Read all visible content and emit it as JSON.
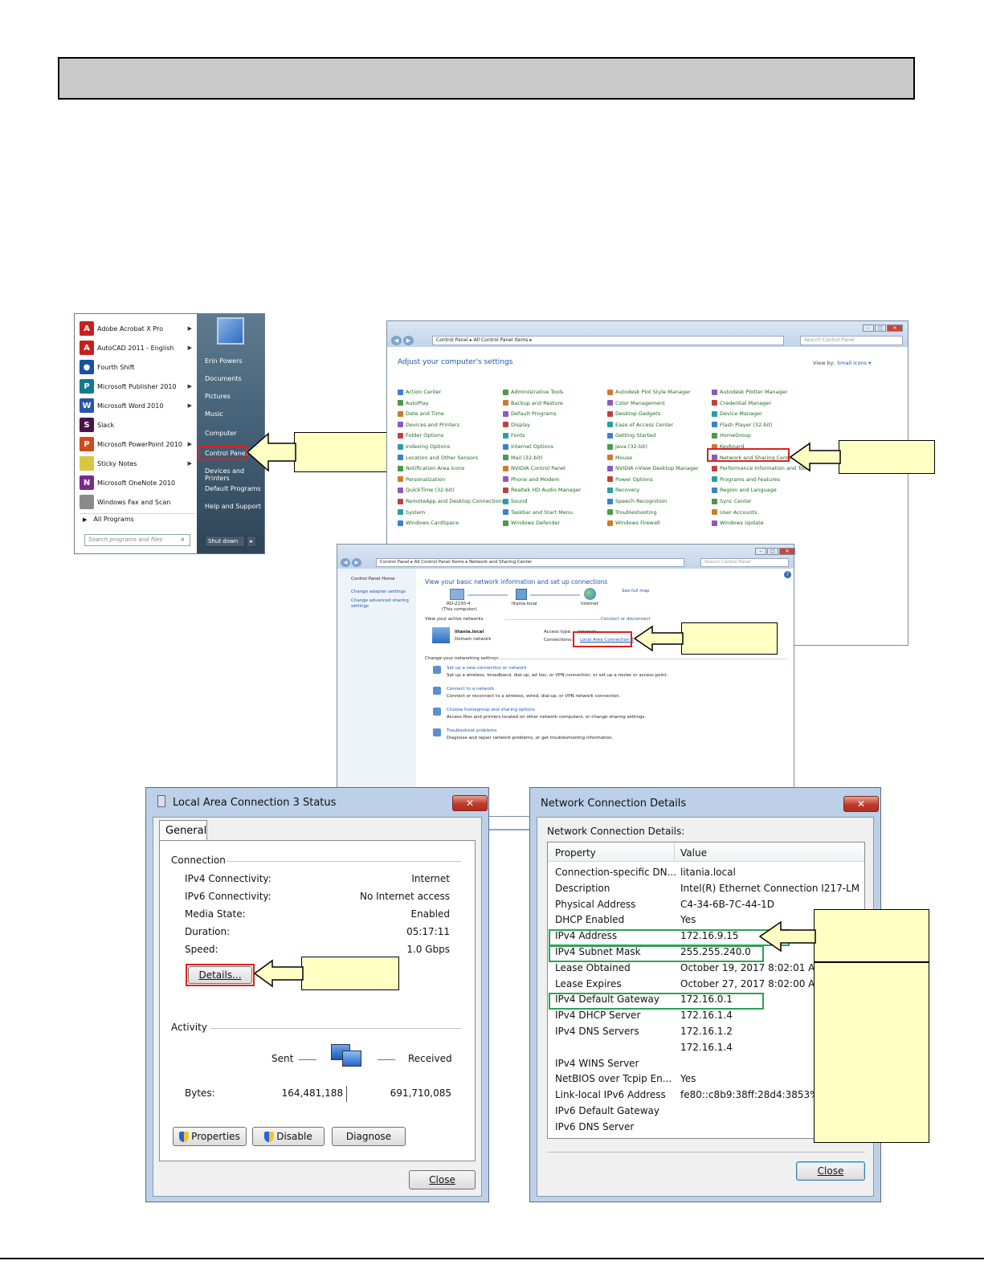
{
  "start_menu": {
    "programs": [
      {
        "label": "Adobe Acrobat X Pro",
        "icon": "acrobat-icon",
        "color": "#c8201f",
        "glyph": "A",
        "has_arrow": true
      },
      {
        "label": "AutoCAD 2011 - English",
        "icon": "autocad-icon",
        "color": "#c81e1e",
        "glyph": "A",
        "has_arrow": true
      },
      {
        "label": "Fourth Shift",
        "icon": "fourth-shift-icon",
        "color": "#1a4ea0",
        "glyph": "●",
        "has_arrow": false
      },
      {
        "label": "Microsoft Publisher 2010",
        "icon": "publisher-icon",
        "color": "#117a8b",
        "glyph": "P",
        "has_arrow": true
      },
      {
        "label": "Microsoft Word 2010",
        "icon": "word-icon",
        "color": "#2a55a8",
        "glyph": "W",
        "has_arrow": true
      },
      {
        "label": "Slack",
        "icon": "slack-icon",
        "color": "#4a154b",
        "glyph": "S",
        "has_arrow": false
      },
      {
        "label": "Microsoft PowerPoint 2010",
        "icon": "powerpoint-icon",
        "color": "#d04a1c",
        "glyph": "P",
        "has_arrow": true
      },
      {
        "label": "Sticky Notes",
        "icon": "sticky-notes-icon",
        "color": "#d8c640",
        "glyph": "",
        "has_arrow": true
      },
      {
        "label": "Microsoft OneNote 2010",
        "icon": "onenote-icon",
        "color": "#7a2a8c",
        "glyph": "N",
        "has_arrow": false
      },
      {
        "label": "Windows Fax and Scan",
        "icon": "fax-scan-icon",
        "color": "#8a8a8a",
        "glyph": "",
        "has_arrow": false
      }
    ],
    "all_programs": "All Programs",
    "search_placeholder": "Search programs and files",
    "right_items": [
      "Erin Powers",
      "Documents",
      "Pictures",
      "Music",
      "Computer",
      "Control Panel",
      "Devices and Printers",
      "Default Programs",
      "Help and Support"
    ],
    "shutdown": "Shut down"
  },
  "control_panel": {
    "address": "Control Panel  ▸  All Control Panel Items  ▸",
    "search": "Search Control Panel",
    "heading": "Adjust your computer's settings",
    "view_by_label": "View by:",
    "view_by_value": "Small icons ▾",
    "columns": [
      [
        "Action Center",
        "AutoPlay",
        "Date and Time",
        "Devices and Printers",
        "Folder Options",
        "Indexing Options",
        "Location and Other Sensors",
        "Notification Area Icons",
        "Personalization",
        "QuickTime (32-bit)",
        "RemoteApp and Desktop Connections",
        "System",
        "Windows CardSpace"
      ],
      [
        "Administrative Tools",
        "Backup and Restore",
        "Default Programs",
        "Display",
        "Fonts",
        "Internet Options",
        "Mail (32-bit)",
        "NVIDIA Control Panel",
        "Phone and Modem",
        "Realtek HD Audio Manager",
        "Sound",
        "Taskbar and Start Menu",
        "Windows Defender"
      ],
      [
        "Autodesk Plot Style Manager",
        "Color Management",
        "Desktop Gadgets",
        "Ease of Access Center",
        "Getting Started",
        "Java (32-bit)",
        "Mouse",
        "NVIDIA nView Desktop Manager",
        "Power Options",
        "Recovery",
        "Speech Recognition",
        "Troubleshooting",
        "Windows Firewall"
      ],
      [
        "Autodesk Plotter Manager",
        "Credential Manager",
        "Device Manager",
        "Flash Player (32-bit)",
        "HomeGroup",
        "Keyboard",
        "Network and Sharing Center",
        "Performance Information and Tools",
        "Programs and Features",
        "Region and Language",
        "Sync Center",
        "User Accounts",
        "Windows Update"
      ]
    ]
  },
  "network_center": {
    "address": "Control Panel  ▸  All Control Panel Items  ▸  Network and Sharing Center",
    "search": "Search Control Panel",
    "sidebar": [
      "Control Panel Home",
      "Change adapter settings",
      "Change advanced sharing settings"
    ],
    "heading": "View your basic network information and set up connections",
    "see_full_map": "See full map",
    "nodes": [
      "RD-2230-4",
      "(This computer)",
      "litania.local",
      "Internet"
    ],
    "active_label": "View your active networks",
    "connect_link": "Connect or disconnect",
    "network_name": "litania.local",
    "network_type": "Domain network",
    "access_type_label": "Access type:",
    "access_type_value": "Internet",
    "connections_label": "Connections:",
    "connections_value": "Local Area Connection 3",
    "change_label": "Change your networking settings",
    "tasks": [
      {
        "link": "Set up a new connection or network",
        "desc": "Set up a wireless, broadband, dial-up, ad hoc, or VPN connection; or set up a router or access point."
      },
      {
        "link": "Connect to a network",
        "desc": "Connect or reconnect to a wireless, wired, dial-up, or VPN network connection."
      },
      {
        "link": "Choose homegroup and sharing options",
        "desc": "Access files and printers located on other network computers, or change sharing settings."
      },
      {
        "link": "Troubleshoot problems",
        "desc": "Diagnose and repair network problems, or get troubleshooting information."
      }
    ]
  },
  "status_dialog": {
    "title": "Local Area Connection 3 Status",
    "tab": "General",
    "connection_group": "Connection",
    "rows": [
      {
        "label": "IPv4 Connectivity:",
        "value": "Internet"
      },
      {
        "label": "IPv6 Connectivity:",
        "value": "No Internet access"
      },
      {
        "label": "Media State:",
        "value": "Enabled"
      },
      {
        "label": "Duration:",
        "value": "05:17:11"
      },
      {
        "label": "Speed:",
        "value": "1.0 Gbps"
      }
    ],
    "details_button": "Details...",
    "activity_group": "Activity",
    "sent_label": "Sent",
    "received_label": "Received",
    "bytes_label": "Bytes:",
    "bytes_sent": "164,481,188",
    "bytes_received": "691,710,085",
    "properties_button": "Properties",
    "disable_button": "Disable",
    "diagnose_button": "Diagnose",
    "close_button": "Close"
  },
  "details_dialog": {
    "title": "Network Connection Details",
    "subtitle": "Network Connection Details:",
    "col_property": "Property",
    "col_value": "Value",
    "rows": [
      {
        "property": "Connection-specific DN...",
        "value": "litania.local"
      },
      {
        "property": "Description",
        "value": "Intel(R) Ethernet Connection I217-LM"
      },
      {
        "property": "Physical Address",
        "value": "C4-34-6B-7C-44-1D"
      },
      {
        "property": "DHCP Enabled",
        "value": "Yes"
      },
      {
        "property": "IPv4 Address",
        "value": "172.16.9.15"
      },
      {
        "property": "IPv4 Subnet Mask",
        "value": "255.255.240.0"
      },
      {
        "property": "Lease Obtained",
        "value": "October 19, 2017 8:02:01 AM"
      },
      {
        "property": "Lease Expires",
        "value": "October 27, 2017 8:02:00 AM"
      },
      {
        "property": "IPv4 Default Gateway",
        "value": "172.16.0.1"
      },
      {
        "property": "IPv4 DHCP Server",
        "value": "172.16.1.4"
      },
      {
        "property": "IPv4 DNS Servers",
        "value": "172.16.1.2"
      },
      {
        "property": "",
        "value": "172.16.1.4"
      },
      {
        "property": "IPv4 WINS Server",
        "value": ""
      },
      {
        "property": "NetBIOS over Tcpip En...",
        "value": "Yes"
      },
      {
        "property": "Link-local IPv6 Address",
        "value": "fe80::c8b9:38ff:28d4:3853%14"
      },
      {
        "property": "IPv6 Default Gateway",
        "value": ""
      },
      {
        "property": "IPv6 DNS Server",
        "value": ""
      }
    ],
    "close_button": "Close"
  },
  "colors": {
    "highlight_red": "#e02020",
    "highlight_green": "#2aa35a",
    "callout_fill": "#ffffc4",
    "header_bar": "#c9c9c9"
  }
}
